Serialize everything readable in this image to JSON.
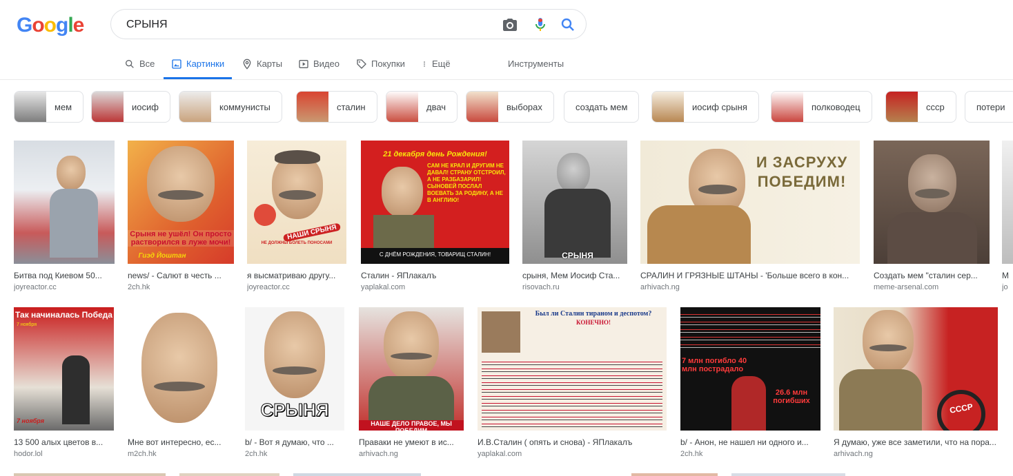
{
  "logo": [
    "G",
    "o",
    "o",
    "g",
    "l",
    "e"
  ],
  "logo_colors": [
    "#4285f4",
    "#ea4335",
    "#fbbc05",
    "#4285f4",
    "#34a853",
    "#ea4335"
  ],
  "search": {
    "value": "СРЫНЯ"
  },
  "icons": {
    "camera": "camera-icon",
    "mic": "microphone-icon",
    "search": "search-icon"
  },
  "tabs": [
    {
      "label": "Все",
      "icon": "search-icon"
    },
    {
      "label": "Картинки",
      "icon": "image-icon",
      "active": true
    },
    {
      "label": "Карты",
      "icon": "map-pin-icon"
    },
    {
      "label": "Видео",
      "icon": "video-icon"
    },
    {
      "label": "Покупки",
      "icon": "tag-icon"
    },
    {
      "label": "Ещё",
      "icon": "more-vert-icon"
    },
    {
      "label": "Инструменты"
    }
  ],
  "chips": [
    {
      "label": "мем"
    },
    {
      "label": "иосиф"
    },
    {
      "label": "коммунисты"
    },
    {
      "label": "сталин"
    },
    {
      "label": "двач"
    },
    {
      "label": "выборах"
    },
    {
      "label": "создать мем"
    },
    {
      "label": "иосиф срыня"
    },
    {
      "label": "полководец"
    },
    {
      "label": "ссср"
    },
    {
      "label": "потери"
    }
  ],
  "results": [
    {
      "caption": "Битва под Киевом 50...",
      "source": "joyreactor.cc"
    },
    {
      "caption": "news/ - Салют в честь ...",
      "source": "2ch.hk",
      "text": "Срыня не ушёл! Он просто растворился в луже мочи!",
      "text2": "Гиэд Йоштан"
    },
    {
      "caption": "я высматриваю другу...",
      "source": "joyreactor.cc",
      "text": "НАШИ СРЫНЯ",
      "text2": "НЕ ДОЛЖНЫ БОЛЕТЬ ПОНОСАМИ"
    },
    {
      "caption": "Сталин - ЯПлакалъ",
      "source": "yaplakal.com",
      "text": "21 декабря день Рождения!",
      "text2": "САМ НЕ КРАЛ И ДРУГИМ НЕ ДАВАЛ! СТРАНУ ОТСТРОИЛ, А НЕ РАЗБАЗАРИЛ! СЫНОВЕЙ ПОСЛАЛ ВОЕВАТЬ ЗА РОДИНУ, А НЕ В АНГЛИЮ!",
      "text3": "С ДНЁМ РОЖДЕНИЯ, ТОВАРИЩ СТАЛИН!"
    },
    {
      "caption": "срыня, Мем Иосиф Ста...",
      "source": "risovach.ru",
      "text": "СРЫНЯ"
    },
    {
      "caption": "СРАЛИН И ГРЯЗНЫЕ ШТАНЫ - 'Больше всего в кон...",
      "source": "arhivach.ng",
      "text": "И ЗАСРУХУ ПОБЕДИМ!"
    },
    {
      "caption": "Создать мем \"сталин сер...",
      "source": "meme-arsenal.com"
    },
    {
      "caption": "М",
      "source": "jo"
    },
    {
      "caption": "13 500 алых цветов в...",
      "source": "hodor.lol",
      "text": "Так начиналась Победа",
      "text2": "7 ноября"
    },
    {
      "caption": "Мне вот интересно, ес...",
      "source": "m2ch.hk"
    },
    {
      "caption": "b/ - Вот я думаю, что ...",
      "source": "2ch.hk",
      "text": "СРЫНЯ"
    },
    {
      "caption": "Правaки не умеют в ис...",
      "source": "arhivach.ng",
      "text": "НАШЕ ДЕЛО ПРАВОЕ, МЫ ПОБЕДИМ"
    },
    {
      "caption": "И.В.Сталин ( опять и снова) - ЯПлакалъ",
      "source": "yaplakal.com",
      "text": "Был ли Сталин тираном и деспотом?",
      "text2": "КОНЕЧНО!"
    },
    {
      "caption": "b/ - Анон, не нашел ни одного и...",
      "source": "2ch.hk",
      "text": "7 млн погибло 40 млн пострадало",
      "text2": "26.6 млн погибших"
    },
    {
      "caption": "Я думаю, уже все заметили, что на пора...",
      "source": "arhivach.ng",
      "text": "СССР"
    }
  ]
}
